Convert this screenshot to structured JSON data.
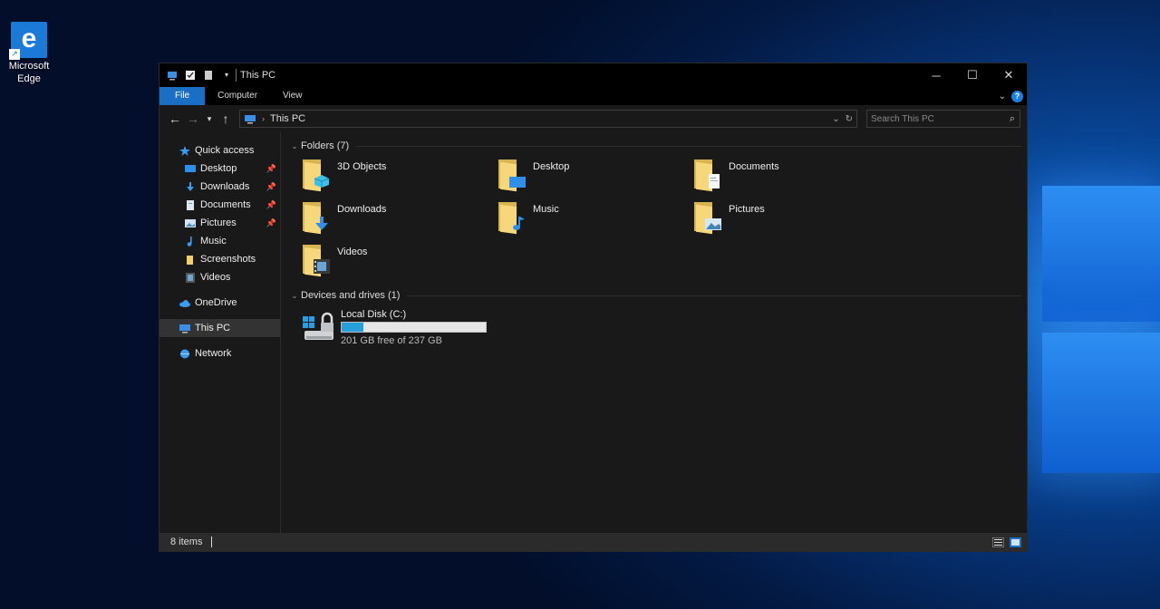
{
  "desktop": {
    "icons": [
      {
        "label": "Microsoft Edge",
        "icon": "edge-icon"
      }
    ]
  },
  "window": {
    "title": "This PC",
    "controls": {
      "minimize": "─",
      "maximize": "☐",
      "close": "✕"
    },
    "ribbon_tabs": [
      "File",
      "Computer",
      "View"
    ],
    "help": "?"
  },
  "navigation": {
    "breadcrumb": "This PC",
    "search_placeholder": "Search This PC"
  },
  "sidebar": {
    "items": [
      {
        "label": "Quick access",
        "icon": "star-icon",
        "pinned": false
      },
      {
        "label": "Desktop",
        "icon": "desktop-icon",
        "pinned": true
      },
      {
        "label": "Downloads",
        "icon": "download-icon",
        "pinned": true
      },
      {
        "label": "Documents",
        "icon": "document-icon",
        "pinned": true
      },
      {
        "label": "Pictures",
        "icon": "picture-icon",
        "pinned": true
      },
      {
        "label": "Music",
        "icon": "music-icon",
        "pinned": false
      },
      {
        "label": "Screenshots",
        "icon": "folder-icon",
        "pinned": false
      },
      {
        "label": "Videos",
        "icon": "video-icon",
        "pinned": false
      },
      {
        "label": "OneDrive",
        "icon": "cloud-icon",
        "pinned": false
      },
      {
        "label": "This PC",
        "icon": "pc-icon",
        "pinned": false,
        "selected": true
      },
      {
        "label": "Network",
        "icon": "network-icon",
        "pinned": false
      }
    ]
  },
  "content": {
    "folders_header": "Folders (7)",
    "folders": [
      {
        "label": "3D Objects",
        "overlay": "cube-icon"
      },
      {
        "label": "Desktop",
        "overlay": "desktop-icon"
      },
      {
        "label": "Documents",
        "overlay": "document-icon"
      },
      {
        "label": "Downloads",
        "overlay": "download-icon"
      },
      {
        "label": "Music",
        "overlay": "music-icon"
      },
      {
        "label": "Pictures",
        "overlay": "picture-icon"
      },
      {
        "label": "Videos",
        "overlay": "video-icon"
      }
    ],
    "drives_header": "Devices and drives (1)",
    "drives": [
      {
        "label": "Local Disk (C:)",
        "free_text": "201 GB free of 237 GB",
        "used_fraction": 0.15
      }
    ]
  },
  "status": {
    "item_count": "8 items"
  },
  "colors": {
    "accent": "#1a6fc4",
    "window_bg": "#191919",
    "folder": "#f6d77a",
    "drive_bar": "#26a0da"
  }
}
